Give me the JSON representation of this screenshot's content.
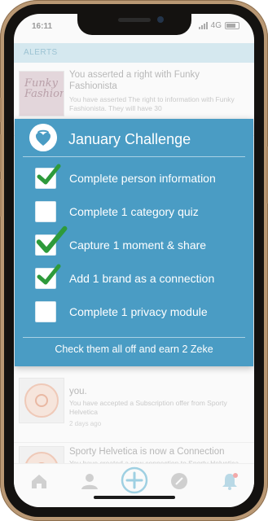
{
  "status": {
    "time": "16:11",
    "network": "4G"
  },
  "alerts_header": "ALERTS",
  "feed": [
    {
      "title": "You asserted a right with Funky Fashionista",
      "body": "You have asserted The right to information with Funky Fashionista. They will have 30",
      "thumb_text": "Funky Fashionista"
    },
    {
      "title": "you.",
      "body": "You have accepted a Subscription offer from Sporty Helvetica",
      "time": "2 days ago"
    },
    {
      "title": "Sporty Helvetica is now a Connection",
      "body": "You have created a new connection to Sporty Helvetica."
    }
  ],
  "modal": {
    "title": "January Challenge",
    "tasks": [
      {
        "label": "Complete person information",
        "checked": true
      },
      {
        "label": "Complete 1 category quiz",
        "checked": false
      },
      {
        "label": "Capture 1 moment & share",
        "checked": true
      },
      {
        "label": "Add 1 brand as a connection",
        "checked": true
      },
      {
        "label": "Complete 1 privacy module",
        "checked": false
      }
    ],
    "footer": "Check them all off and earn 2 Zeke"
  },
  "tabs": [
    "home-icon",
    "profile-icon",
    "add-icon",
    "offers-icon",
    "alerts-icon"
  ],
  "colors": {
    "modal": "#4a9cc4",
    "check": "#2e9a3b",
    "alerts_bar": "#d5e8ef"
  }
}
